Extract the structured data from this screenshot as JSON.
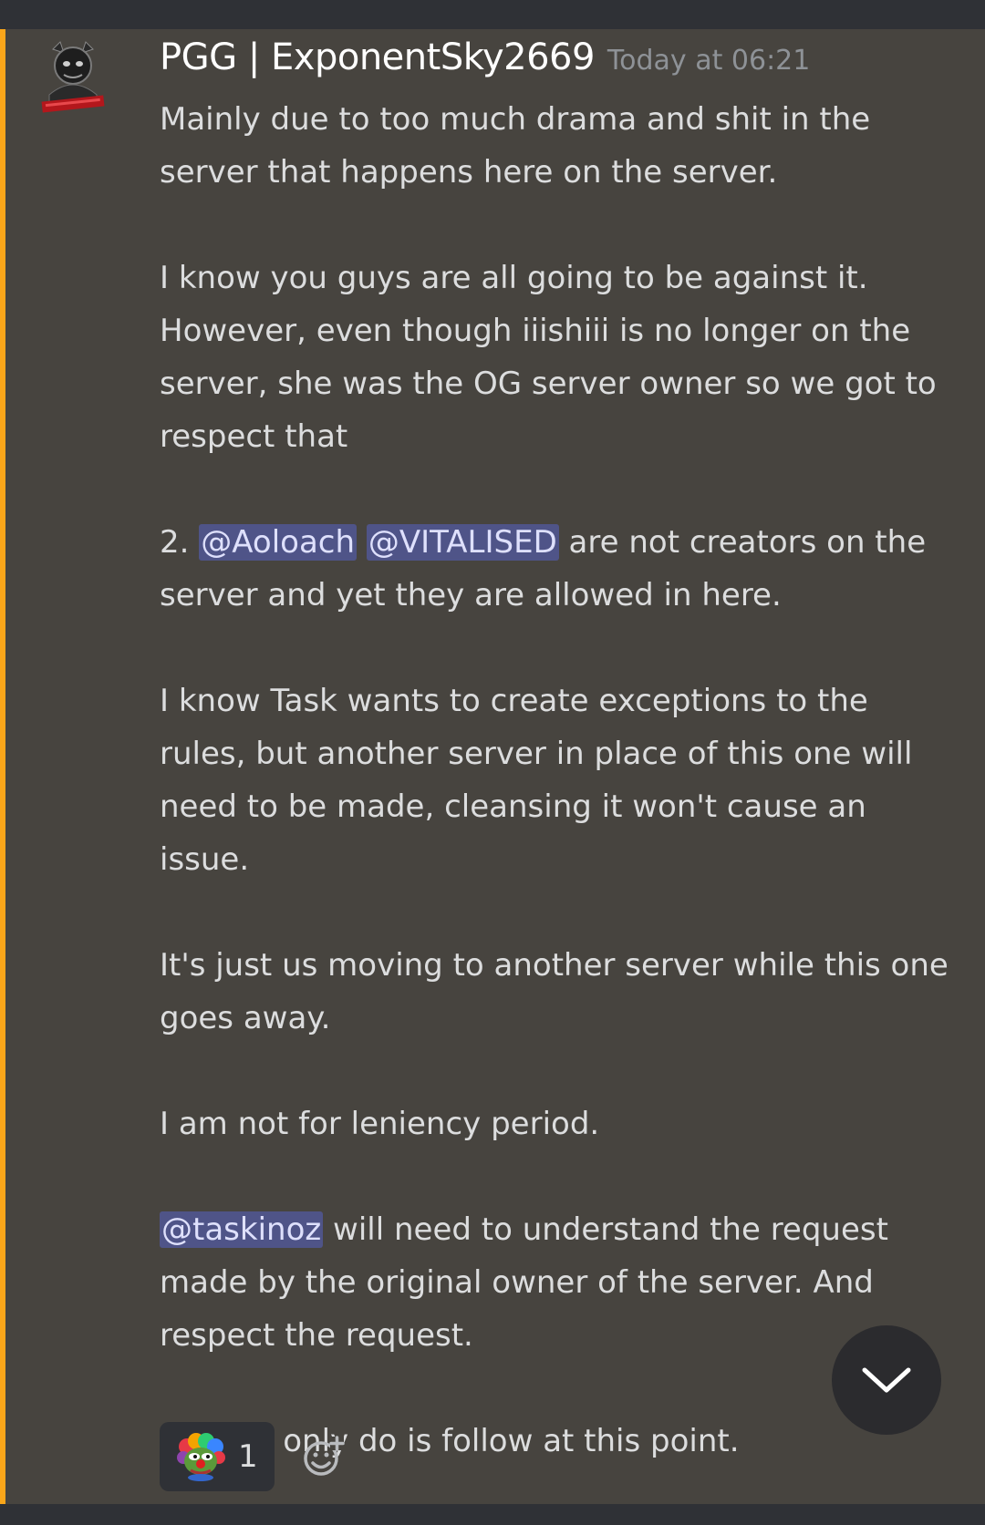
{
  "message": {
    "author": "PGG | ExponentSky2669",
    "timestamp": "Today at 06:21",
    "paragraphs": {
      "p1": "Mainly due to too much drama and shit in the server that happens here on the server.",
      "p2": "I know you guys are all going to be against it. However, even though iiishiii is no longer on the server, she was the OG server owner so we got to respect that",
      "p3_prefix": "2. ",
      "p3_mention1": "@Aoloach",
      "p3_mention2": "@VITALISED",
      "p3_suffix": " are not creators on the server and yet they are allowed in here.",
      "p4": "I know Task wants to create exceptions to the rules, but another server in place of this one will need to be made, cleansing it won't cause an issue.",
      "p5": "It's just us moving to another server while this one goes away.",
      "p6": "I am not for leniency period.",
      "p7_mention": "@taskinoz",
      "p7_suffix": " will need to understand the request made by the original owner of the server. And respect the request.",
      "p8": "We can only do is follow at this point."
    },
    "reactions": [
      {
        "emoji": "clown-pepe-emoji",
        "count": "1"
      }
    ]
  },
  "colors": {
    "message_bg": "#47443f",
    "highlight_bar": "#faa61a",
    "mention_bg": "#4f5488",
    "timestamp": "#8e9297",
    "text": "#dcddde"
  },
  "icons": {
    "avatar": "avatar-icon",
    "add_reaction": "add-reaction-icon",
    "jump": "chevron-down-icon"
  }
}
